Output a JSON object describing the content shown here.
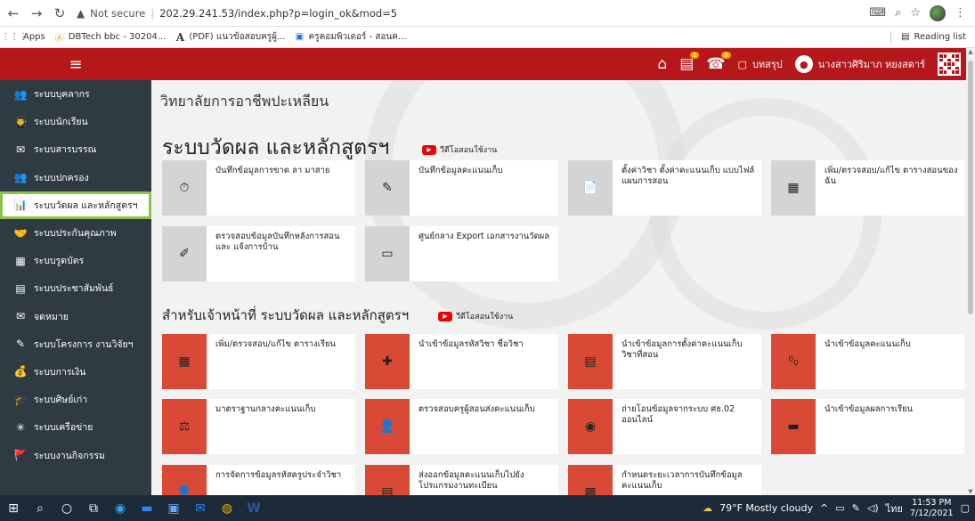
{
  "browser": {
    "url_prefix": "Not secure",
    "url": "202.29.241.53/index.php?p=login_ok&mod=5",
    "bookmarks": [
      {
        "label": "Apps",
        "icon": "apps-grid-icon"
      },
      {
        "label": "DBTech bbc - 30204...",
        "icon": "dbtech-icon"
      },
      {
        "label": "(PDF) แนวข้อสอบครูผู้...",
        "icon": "pdf-a-icon"
      },
      {
        "label": "ครูคอมพิวเตอร์ - สอนค...",
        "icon": "calendar-icon"
      }
    ],
    "reading_list": "Reading list"
  },
  "header": {
    "menu_icon": "≡",
    "summary_label": "บทสรุป",
    "user_name": "นางสาวศิริมาภ หยงสตาร์",
    "badge_count": "8"
  },
  "sidebar": {
    "items": [
      {
        "label": "ระบบบุคลากร",
        "icon": "people-icon",
        "glyph": "👥",
        "active": false
      },
      {
        "label": "ระบบนักเรียน",
        "icon": "students-icon",
        "glyph": "👨‍🎓",
        "active": false
      },
      {
        "label": "ระบบสารบรรณ",
        "icon": "mail-icon",
        "glyph": "✉",
        "active": false
      },
      {
        "label": "ระบบปกครอง",
        "icon": "guardian-icon",
        "glyph": "👥",
        "active": false
      },
      {
        "label": "ระบบวัดผล และหลักสูตรฯ",
        "icon": "chart-icon",
        "glyph": "📊",
        "active": true
      },
      {
        "label": "ระบบประกันคุณภาพ",
        "icon": "handshake-icon",
        "glyph": "🤝",
        "active": false
      },
      {
        "label": "ระบบรูดบัตร",
        "icon": "card-icon",
        "glyph": "▦",
        "active": false
      },
      {
        "label": "ระบบประชาสัมพันธ์",
        "icon": "news-icon",
        "glyph": "▤",
        "active": false
      },
      {
        "label": "จดหมาย",
        "icon": "letter-icon",
        "glyph": "✉",
        "active": false
      },
      {
        "label": "ระบบโครงการ งานวิจัยฯ",
        "icon": "project-icon",
        "glyph": "✎",
        "active": false
      },
      {
        "label": "ระบบการเงิน",
        "icon": "money-icon",
        "glyph": "💰",
        "active": false
      },
      {
        "label": "ระบบศิษย์เก่า",
        "icon": "alumni-icon",
        "glyph": "🎓",
        "active": false
      },
      {
        "label": "ระบบเครือข่าย",
        "icon": "network-icon",
        "glyph": "✳",
        "active": false
      },
      {
        "label": "ระบบงานกิจกรรม",
        "icon": "activity-icon",
        "glyph": "🚩",
        "active": false
      }
    ]
  },
  "main": {
    "college": "วิทยาลัยการอาชีพปะเหลียน",
    "section1": {
      "title": "ระบบวัดผล และหลักสูตรฯ",
      "video_label": "วีดีโอสอนใช้งาน",
      "cards": [
        {
          "label": "บันทึกข้อมูลการขาด ลา มาสาย",
          "icon": "attendance-icon",
          "glyph": "⏱"
        },
        {
          "label": "บันทึกข้อมูลคะแนนเก็บ",
          "icon": "edit-score-icon",
          "glyph": "✎"
        },
        {
          "label": "ตั้งค่าวิชา ตั้งค่าคะแนนเก็บ แบบไฟล์แผนการสอน",
          "icon": "file-settings-icon",
          "glyph": "📄"
        },
        {
          "label": "เพิ่ม/ตรวจสอบ/แก้ไข ตารางสอนของฉัน",
          "icon": "timetable-icon",
          "glyph": "▦"
        },
        {
          "label": "ตรวจสอบข้อมูลบันทึกหลังการสอน และ แจ้งการบ้าน",
          "icon": "check-note-icon",
          "glyph": "✐"
        },
        {
          "label": "ศูนย์กลาง Export เอกสารงานวัดผล",
          "icon": "export-doc-icon",
          "glyph": "▭"
        }
      ]
    },
    "section2": {
      "title": "สำหรับเจ้าหน้าที่ ระบบวัดผล และหลักสูตรฯ",
      "video_label": "วีดีโอสอนใช้งาน",
      "cards": [
        {
          "label": "เพิ่ม/ตรวจสอบ/แก้ไข ตารางเรียน",
          "icon": "class-schedule-icon",
          "glyph": "▦"
        },
        {
          "label": "นำเข้าข้อมูลรหัสวิชา ชื่อวิชา",
          "icon": "import-subject-icon",
          "glyph": "✚"
        },
        {
          "label": "นำเข้าข้อมูลการตั้งค่าคะแนนเก็บวิชาที่สอน",
          "icon": "import-setting-icon",
          "glyph": "▤"
        },
        {
          "label": "นำเข้าข้อมูลคะแนนเก็บ",
          "icon": "import-score-icon",
          "glyph": "⁰₀"
        },
        {
          "label": "มาตราฐานกลางคะแนนเก็บ",
          "icon": "scale-icon",
          "glyph": "⚖"
        },
        {
          "label": "ตรวจสอบครูผู้สอนส่งคะแนนเก็บ",
          "icon": "teacher-check-icon",
          "glyph": "👤"
        },
        {
          "label": "ถ่ายโอนข้อมูลจากระบบ ศธ.02 ออนไลน์",
          "icon": "transfer-icon",
          "glyph": "◉"
        },
        {
          "label": "นำเข้าข้อมูลผลการเรียน",
          "icon": "import-result-icon",
          "glyph": "▬"
        },
        {
          "label": "การจัดการข้อมูลรหัสครูประจำวิชา",
          "icon": "teacher-code-icon",
          "glyph": "👤"
        },
        {
          "label": "ส่งออกข้อมูลคะแนนเก็บไปยังโปรแกรมงานทะเบียน",
          "icon": "export-score-icon",
          "glyph": "▤"
        },
        {
          "label": "กำหนดระยะเวลาการบันทึกข้อมูลคะแนนเก็บ",
          "icon": "time-limit-icon",
          "glyph": "▦"
        }
      ]
    }
  },
  "taskbar": {
    "weather": "79°F  Mostly cloudy",
    "lang": "ไทย",
    "time": "11:53 PM",
    "date": "7/12/2021"
  }
}
